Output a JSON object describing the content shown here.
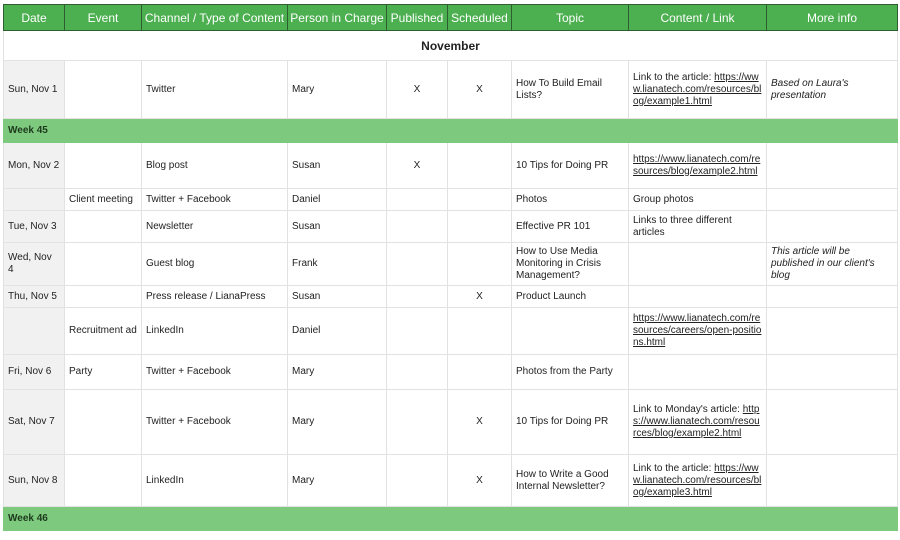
{
  "headers": [
    "Date",
    "Event",
    "Channel / Type of Content",
    "Person in Charge",
    "Published",
    "Scheduled",
    "Topic",
    "Content / Link",
    "More info"
  ],
  "month_label": "November",
  "colors": {
    "header_bg": "#4caf50",
    "week_bg": "#7dc97d",
    "date_col_bg": "#f1f1f1"
  },
  "rows": [
    {
      "date": "Sun, Nov 1",
      "event": "",
      "channel": "Twitter",
      "person": "Mary",
      "published": "X",
      "scheduled": "X",
      "topic": "How To Build Email Lists?",
      "content_prefix": "Link to the article: ",
      "content_link": "https://www.lianatech.com/resources/blog/example1.html",
      "more": "Based on Laura's presentation"
    },
    {
      "week": "Week 45"
    },
    {
      "date": "Mon, Nov 2",
      "event": "",
      "channel": "Blog post",
      "person": "Susan",
      "published": "X",
      "scheduled": "",
      "topic": "10 Tips for Doing PR",
      "content_prefix": "",
      "content_link": "https://www.lianatech.com/resources/blog/example2.html",
      "more": ""
    },
    {
      "date": "",
      "event": "Client meeting",
      "channel": "Twitter + Facebook",
      "person": "Daniel",
      "published": "",
      "scheduled": "",
      "topic": "Photos",
      "content_prefix": "Group photos",
      "content_link": "",
      "more": ""
    },
    {
      "date": "Tue, Nov 3",
      "event": "",
      "channel": "Newsletter",
      "person": "Susan",
      "published": "",
      "scheduled": "",
      "topic": "Effective PR 101",
      "content_prefix": "Links to three different articles",
      "content_link": "",
      "more": ""
    },
    {
      "date": "Wed, Nov 4",
      "event": "",
      "channel": "Guest blog",
      "person": "Frank",
      "published": "",
      "scheduled": "",
      "topic": "How to Use Media Monitoring in Crisis Management?",
      "content_prefix": "",
      "content_link": "",
      "more": "This article will be published in our client's blog"
    },
    {
      "date": "Thu, Nov 5",
      "event": "",
      "channel": "Press release / LianaPress",
      "person": "Susan",
      "published": "",
      "scheduled": "X",
      "topic": "Product Launch",
      "content_prefix": "",
      "content_link": "",
      "more": ""
    },
    {
      "date": "",
      "event": "Recruitment ad",
      "channel": "LinkedIn",
      "person": "Daniel",
      "published": "",
      "scheduled": "",
      "topic": "",
      "content_prefix": "",
      "content_link": "https://www.lianatech.com/resources/careers/open-positions.html",
      "more": ""
    },
    {
      "date": "Fri, Nov 6",
      "event": "Party",
      "channel": "Twitter + Facebook",
      "person": "Mary",
      "published": "",
      "scheduled": "",
      "topic": "Photos from the Party",
      "content_prefix": "",
      "content_link": "",
      "more": ""
    },
    {
      "date": "Sat, Nov 7",
      "event": "",
      "channel": "Twitter + Facebook",
      "person": "Mary",
      "published": "",
      "scheduled": "X",
      "topic": "10 Tips for Doing PR",
      "content_prefix": "Link to Monday's article: ",
      "content_link": "https://www.lianatech.com/resources/blog/example2.html",
      "more": ""
    },
    {
      "date": "Sun, Nov 8",
      "event": "",
      "channel": "LinkedIn",
      "person": "Mary",
      "published": "",
      "scheduled": "X",
      "topic": "How to Write a Good Internal Newsletter?",
      "content_prefix": "Link to the article: ",
      "content_link": "https://www.lianatech.com/resources/blog/example3.html",
      "more": ""
    },
    {
      "week": "Week 46"
    }
  ]
}
